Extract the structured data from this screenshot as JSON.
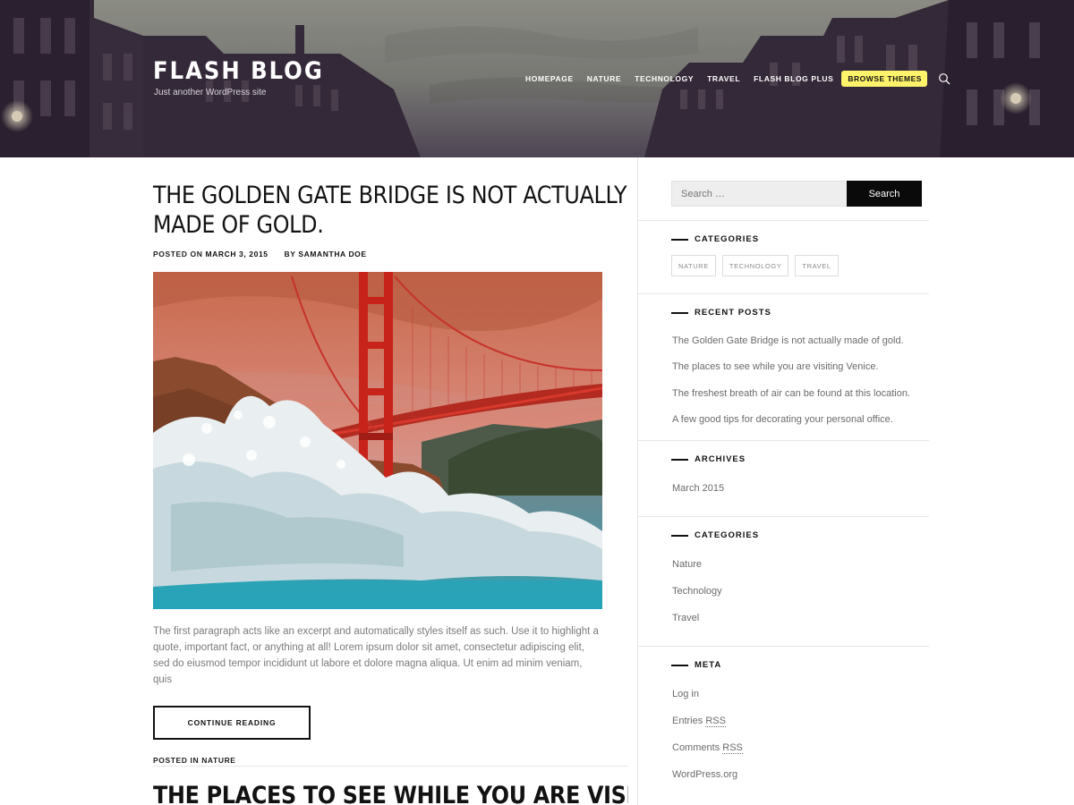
{
  "site": {
    "title": "FLASH BLOG",
    "tagline": "Just another WordPress site"
  },
  "nav": {
    "items": [
      "HOMEPAGE",
      "NATURE",
      "TECHNOLOGY",
      "TRAVEL",
      "FLASH BLOG PLUS"
    ],
    "cta": "BROWSE THEMES",
    "search_icon": "search-icon",
    "cta_color": "#fff36b"
  },
  "post": {
    "title": "THE GOLDEN GATE BRIDGE IS NOT ACTUALLY MADE OF GOLD.",
    "meta_posted_label": "POSTED ON",
    "meta_date": "MARCH 3, 2015",
    "meta_by_label": "BY",
    "meta_author": "SAMANTHA DOE",
    "excerpt": "The first paragraph acts like an excerpt and automatically styles itself as such. Use it to highlight a quote, important fact, or anything at all! Lorem ipsum dolor sit amet, consectetur adipiscing elit, sed do eiusmod tempor incididunt ut labore et dolore magna aliqua. Ut enim ad minim veniam, quis",
    "continue_label": "CONTINUE READING",
    "posted_in_label": "POSTED IN",
    "category": "NATURE"
  },
  "next_post": {
    "title": "THE PLACES TO SEE WHILE YOU ARE VISITING VENICE."
  },
  "sidebar": {
    "search": {
      "placeholder": "Search …",
      "button": "Search"
    },
    "categories_tags": {
      "title": "CATEGORIES",
      "tags": [
        "NATURE",
        "TECHNOLOGY",
        "TRAVEL"
      ]
    },
    "recent_posts": {
      "title": "RECENT POSTS",
      "items": [
        "The Golden Gate Bridge is not actually made of gold.",
        "The places to see while you are visiting Venice.",
        "The freshest breath of air can be found at this location.",
        "A few good tips for decorating your personal office."
      ]
    },
    "archives": {
      "title": "ARCHIVES",
      "items": [
        "March 2015"
      ]
    },
    "categories_list": {
      "title": "CATEGORIES",
      "items": [
        "Nature",
        "Technology",
        "Travel"
      ]
    },
    "meta": {
      "title": "META",
      "login": "Log in",
      "entries_prefix": "Entries",
      "comments_prefix": "Comments",
      "rss": "RSS",
      "wordpress": "WordPress.org"
    }
  }
}
